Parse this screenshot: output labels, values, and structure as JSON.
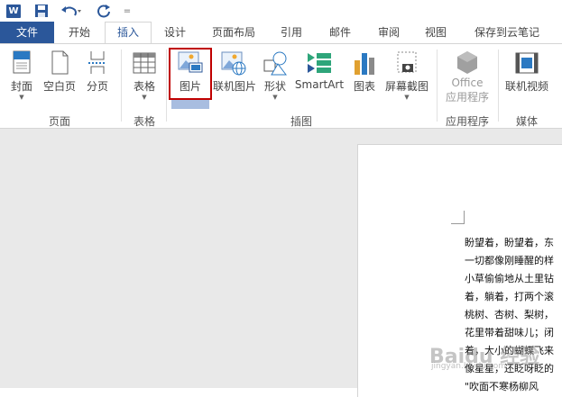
{
  "qat": {
    "word_logo": "W",
    "save_icon": "save-icon",
    "undo_icon": "undo-icon",
    "redo_icon": "redo-icon",
    "customize": "="
  },
  "tabs": [
    {
      "label": "文件"
    },
    {
      "label": "开始"
    },
    {
      "label": "插入"
    },
    {
      "label": "设计"
    },
    {
      "label": "页面布局"
    },
    {
      "label": "引用"
    },
    {
      "label": "邮件"
    },
    {
      "label": "审阅"
    },
    {
      "label": "视图"
    },
    {
      "label": "保存到云笔记"
    }
  ],
  "ribbon": {
    "page_group": {
      "label": "页面",
      "cover": "封面",
      "blank": "空白页",
      "break": "分页"
    },
    "table_group": {
      "label": "表格",
      "table": "表格"
    },
    "illus_group": {
      "label": "插图",
      "picture": "图片",
      "online_picture": "联机图片",
      "shapes": "形状",
      "smartart": "SmartArt",
      "chart": "图表",
      "screenshot": "屏幕截图"
    },
    "apps_group": {
      "label": "应用程序",
      "office_line1": "Office",
      "office_line2": "应用程序"
    },
    "media_group": {
      "label": "媒体",
      "online_video": "联机视频"
    }
  },
  "document": {
    "lines": [
      "盼望着，盼望着，东",
      "一切都像刚睡醒的样",
      "小草偷偷地从土里钻",
      "着，躺着，打两个滚",
      "桃树、杏树、梨树，",
      "花里带着甜味儿；闭",
      "着，大小的蝴蝶飞来",
      "像星星，还眨呀眨的",
      "\"吹面不寒杨柳风"
    ],
    "watermark": "Baidu 经验",
    "watermark_sub": "jingyan.baidu.com"
  },
  "colors": {
    "accent": "#2b579a",
    "highlight": "#c00000"
  }
}
